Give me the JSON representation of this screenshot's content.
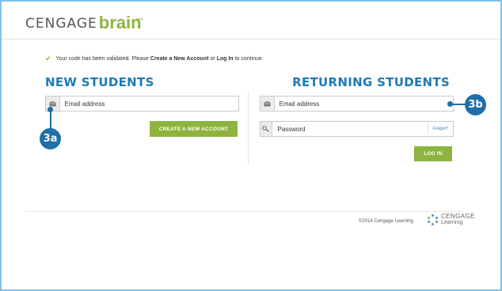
{
  "header": {
    "logo_part1": "CENGAGE",
    "logo_part2": "brain",
    "logo_suffix": ".com"
  },
  "message": {
    "prefix": "Your code has been validated. Please ",
    "create_link": "Create a New Account",
    "middle": " or ",
    "login_link": "Log In",
    "suffix": " to continue."
  },
  "new_students": {
    "heading": "NEW STUDENTS",
    "email_placeholder": "Email address",
    "create_button": "CREATE A NEW ACCOUNT",
    "callout": "3a"
  },
  "returning_students": {
    "heading": "RETURNING STUDENTS",
    "email_placeholder": "Email address",
    "password_placeholder": "Password",
    "forgot_link": "Forgot?",
    "login_button": "LOG IN",
    "callout": "3b"
  },
  "footer": {
    "copyright": "©2014 Cengage Learning",
    "logo_line1": "CENGAGE",
    "logo_line2": "Learning"
  },
  "colors": {
    "accent_green": "#8db43e",
    "heading_blue": "#1e7ab6",
    "callout_blue": "#1f6fa8",
    "frame_border": "#7fc3e8"
  },
  "icons": {
    "email": "envelope-icon",
    "password": "key-icon",
    "check": "checkmark-icon"
  }
}
